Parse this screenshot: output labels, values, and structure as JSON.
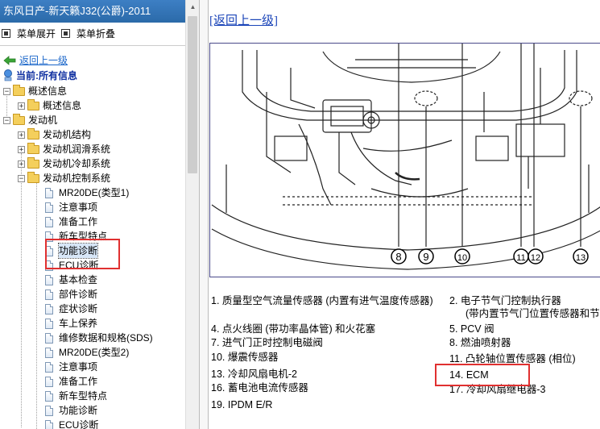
{
  "window": {
    "title": "东风日产-新天籁J32(公爵)-2011"
  },
  "toolbar": {
    "expand_label": "菜单展开",
    "collapse_label": "菜单折叠"
  },
  "nav": {
    "back_label": "返回上一级",
    "current_label": "当前:所有信息"
  },
  "tree": {
    "overview": "概述信息",
    "overview_child": "概述信息",
    "engine": "发动机",
    "engine_structure": "发动机结构",
    "engine_lubrication": "发动机润滑系统",
    "engine_cooling": "发动机冷却系统",
    "engine_control": "发动机控制系统",
    "control_items": [
      "MR20DE(类型1)",
      "注意事项",
      "准备工作",
      "新车型特点",
      "功能诊断",
      "ECU诊断",
      "基本检查",
      "部件诊断",
      "症状诊断",
      "车上保养",
      "维修数据和规格(SDS)",
      "MR20DE(类型2)",
      "注意事项",
      "准备工作",
      "新车型特点",
      "功能诊断",
      "ECU诊断"
    ]
  },
  "content": {
    "back_link": "[返回上一级]",
    "callouts": [
      "8",
      "9",
      "10",
      "11",
      "12",
      "13"
    ],
    "legend": [
      "1.  质量型空气流量传感器 (内置有进气温度传感器)",
      "2.  电子节气门控制执行器",
      "(带内置节气门位置传感器和节",
      "4.  点火线圈 (带功率晶体管) 和火花塞",
      "5.  PCV 阀",
      "7.  进气门正时控制电磁阀",
      "8.  燃油喷射器",
      "10. 爆震传感器",
      "11. 凸轮轴位置传感器 (相位)",
      "13. 冷却风扇电机-2",
      "14. ECM",
      "16. 蓄电池电流传感器",
      "17. 冷却风扇继电器-3",
      "19. IPDM E/R"
    ]
  },
  "colors": {
    "title_bar": "#2b6aa9",
    "highlight": "#e03030",
    "link": "#1a44b8"
  }
}
